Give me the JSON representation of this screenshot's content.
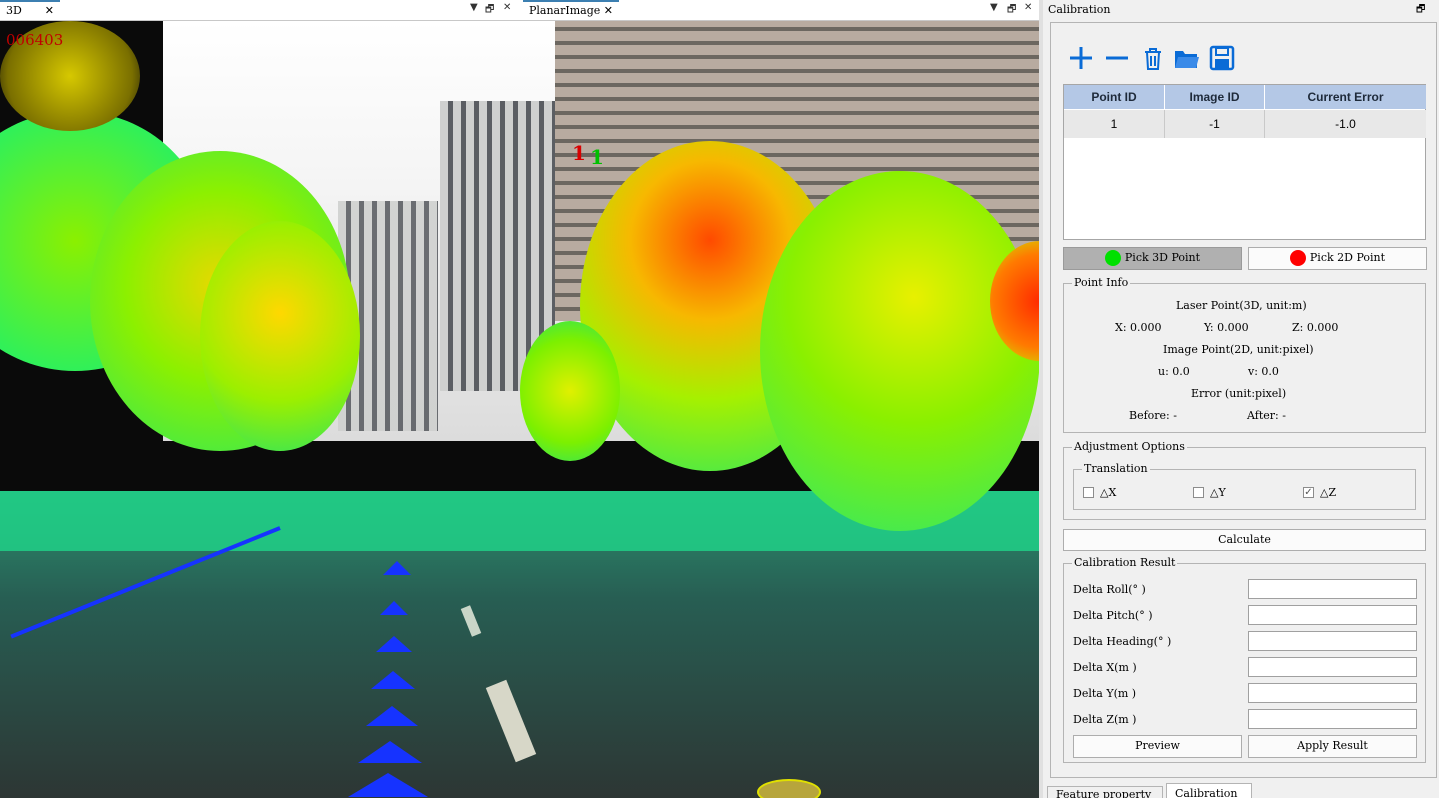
{
  "tabs": {
    "view3d": {
      "label": "3D",
      "close": "✕",
      "dropdown": "▼",
      "float": "🗗"
    },
    "planar": {
      "label": "PlanarImage",
      "close": "✕",
      "dropdown": "▼",
      "float": "🗗"
    },
    "panel": {
      "label": "Calibration",
      "float": "🗗"
    }
  },
  "view3d": {
    "frame_counter": "006403"
  },
  "planar": {
    "marker_red": "1",
    "marker_green": "1"
  },
  "toolbar": {
    "icons": [
      "add-icon",
      "remove-icon",
      "trash-icon",
      "folder-open-icon",
      "save-icon"
    ]
  },
  "table": {
    "columns": [
      "Point ID",
      "Image ID",
      "Current Error"
    ],
    "rows": [
      [
        "1",
        "-1",
        "-1.0"
      ]
    ]
  },
  "pick": {
    "pick3d": "Pick 3D Point",
    "pick2d": "Pick 2D Point",
    "color3d": "#00e000",
    "color2d": "#ff0000"
  },
  "point_info": {
    "title": "Point Info",
    "laser_title": "Laser Point(3D, unit:m)",
    "x": "X: 0.000",
    "y": "Y: 0.000",
    "z": "Z: 0.000",
    "image_title": "Image Point(2D, unit:pixel)",
    "u": "u: 0.0",
    "v": "v: 0.0",
    "error_title": "Error (unit:pixel)",
    "before": "Before: -",
    "after": "After: -"
  },
  "adjust": {
    "title": "Adjustment Options",
    "translation": "Translation",
    "dx": "△X",
    "dy": "△Y",
    "dz": "△Z",
    "dx_checked": false,
    "dy_checked": false,
    "dz_checked": true
  },
  "calculate": "Calculate",
  "result": {
    "title": "Calibration Result",
    "roll": "Delta Roll(° )",
    "pitch": "Delta Pitch(° )",
    "heading": "Delta Heading(° )",
    "dx": "Delta X(m )",
    "dy": "Delta Y(m )",
    "dz": "Delta Z(m )",
    "preview": "Preview",
    "apply": "Apply Result"
  },
  "bottom_tabs": {
    "feature": "Feature property",
    "calibration": "Calibration"
  },
  "colors": {
    "accent": "#3c7fb1",
    "header": "#b4c8e6",
    "icon_blue": "#0a6bd6"
  }
}
